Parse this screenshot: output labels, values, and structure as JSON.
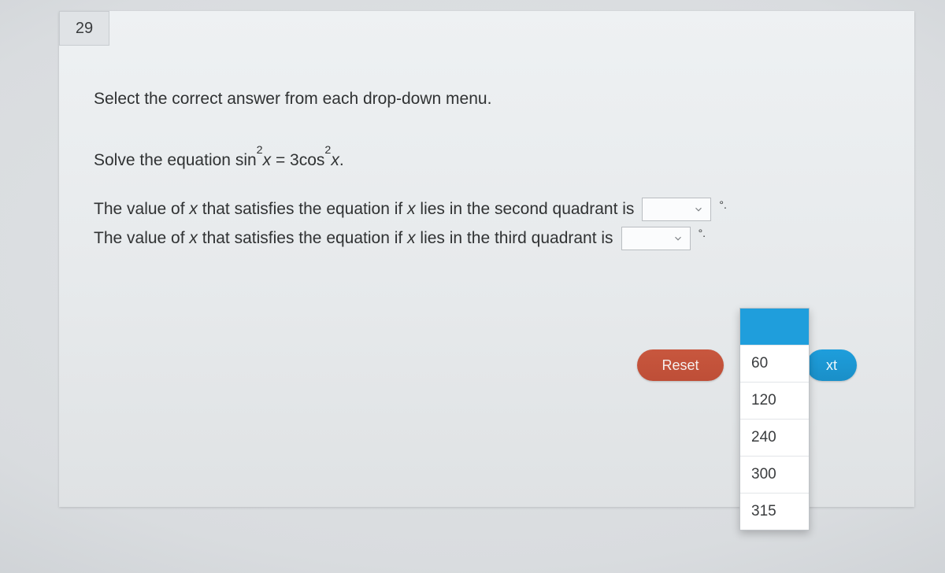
{
  "question_number": "29",
  "instruction": "Select the correct answer from each drop-down menu.",
  "equation": {
    "prefix": "Solve the equation ",
    "fn1": "sin",
    "exp": "2",
    "var": "x",
    "eq": " = 3",
    "fn2": "cos",
    "period": "."
  },
  "line1": {
    "a": "The value of ",
    "var": "x",
    "b": " that satisfies the equation if ",
    "c": " lies in the second quadrant is",
    "unit": "°."
  },
  "line2": {
    "a": "The value of ",
    "var": "x",
    "b": " that satisfies the equation if ",
    "c": " lies in the third quadrant is",
    "unit": "°."
  },
  "dropdown_options": [
    "60",
    "120",
    "240",
    "300",
    "315"
  ],
  "buttons": {
    "reset": "Reset",
    "next_fragment": "xt"
  }
}
